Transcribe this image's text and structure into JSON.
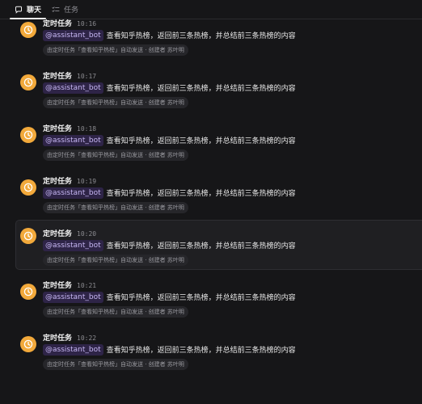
{
  "tabs": [
    {
      "label": "聊天",
      "icon": "chat-bubble-icon",
      "active": true
    },
    {
      "label": "任务",
      "icon": "task-list-icon",
      "active": false
    }
  ],
  "messages": [
    {
      "sender": "定时任务",
      "time": "10:16",
      "mention": "@assistant_bot",
      "content": "查看知乎热榜，返回前三条热榜，并总结前三条热榜的内容",
      "meta": "由定时任务「查看知乎热榜」自动发送 · 创建者 苏叶明"
    },
    {
      "sender": "定时任务",
      "time": "10:17",
      "mention": "@assistant_bot",
      "content": "查看知乎热榜，返回前三条热榜，并总结前三条热榜的内容",
      "meta": "由定时任务「查看知乎热榜」自动发送 · 创建者 苏叶明"
    },
    {
      "sender": "定时任务",
      "time": "10:18",
      "mention": "@assistant_bot",
      "content": "查看知乎热榜，返回前三条热榜，并总结前三条热榜的内容",
      "meta": "由定时任务「查看知乎热榜」自动发送 · 创建者 苏叶明"
    },
    {
      "sender": "定时任务",
      "time": "10:19",
      "mention": "@assistant_bot",
      "content": "查看知乎热榜，返回前三条热榜，并总结前三条热榜的内容",
      "meta": "由定时任务「查看知乎热榜」自动发送 · 创建者 苏叶明"
    },
    {
      "sender": "定时任务",
      "time": "10:20",
      "mention": "@assistant_bot",
      "content": "查看知乎热榜，返回前三条热榜，并总结前三条热榜的内容",
      "meta": "由定时任务「查看知乎热榜」自动发送 · 创建者 苏叶明",
      "highlighted": true
    },
    {
      "sender": "定时任务",
      "time": "10:21",
      "mention": "@assistant_bot",
      "content": "查看知乎热榜，返回前三条热榜，并总结前三条热榜的内容",
      "meta": "由定时任务「查看知乎热榜」自动发送 · 创建者 苏叶明"
    },
    {
      "sender": "定时任务",
      "time": "10:22",
      "mention": "@assistant_bot",
      "content": "查看知乎热榜，返回前三条热榜，并总结前三条热榜的内容",
      "meta": "由定时任务「查看知乎热榜」自动发送 · 创建者 苏叶明"
    }
  ],
  "colors": {
    "background": "#161618",
    "avatar": "#f2a93b",
    "mention_bg": "#2e2447",
    "mention_text": "#c8b8f5",
    "meta_bg": "#26262a"
  },
  "avatar_icon": "clock-icon"
}
